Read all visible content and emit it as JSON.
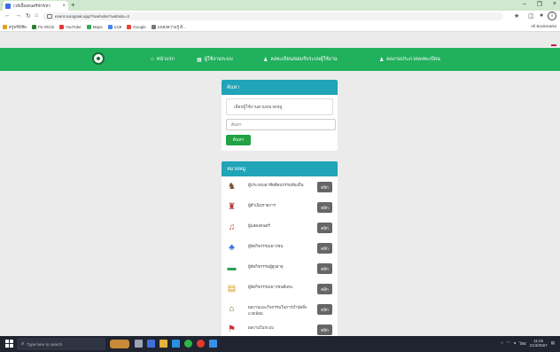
{
  "browser": {
    "tab_title": "เวลีเบื้องดนตรีจักร/หา",
    "url": "event.surognak.app/?/website/?website=3",
    "bookmarks": [
      "ครูฟรีมีชีพ",
      "Pa หน่วย",
      "YouTube",
      "Maps",
      "แปล",
      "Google",
      "แหล่งความรู้ ดิ..."
    ],
    "all_bookmarks": "All Bookmarks"
  },
  "site": {
    "nav": [
      "หน้าแรก",
      "ผู้ใช้งานระบบ",
      "ลงทะเบียน/ยอมรับระบบผู้ใช้งาน",
      "ผลงานประกวดลงทะเบียน"
    ]
  },
  "search_panel": {
    "header": "ค้นหา",
    "note": "เลือกผู้ใช้งานตามหมวดหมู่",
    "input_placeholder": "ค้นหา",
    "button": "ค้นหา"
  },
  "category_panel": {
    "header": "หมวดหมู่",
    "items": [
      {
        "label": "ผู้ประกอบอาชีพศิลปกรรมท้องถิ่น",
        "button": "คลิก",
        "icon": "dancer-icon",
        "color": "#7a4a2a"
      },
      {
        "label": "ผู้ดำเนินรายการ",
        "button": "คลิก",
        "icon": "figure-icon",
        "color": "#b03030"
      },
      {
        "label": "ผู้แสดงดนตรี",
        "button": "คลิก",
        "icon": "music-icon",
        "color": "#c83a3a"
      },
      {
        "label": "ผู้จัดกิจกรรมเยาวชน",
        "button": "คลิก",
        "icon": "tree-icon",
        "color": "#3a6ed8"
      },
      {
        "label": "ผู้จัดกิจกรรมผู้สูงอายุ",
        "button": "คลิก",
        "icon": "chair-icon",
        "color": "#2e9e57"
      },
      {
        "label": "ผู้จัดกิจกรรมเยาวชนดีเด่น",
        "button": "คลิก",
        "icon": "book-icon",
        "color": "#d8a12a"
      },
      {
        "label": "ผลงานและกิจกรรมในการบำบัดสิ่งแวดล้อม",
        "button": "คลิก",
        "icon": "house-icon",
        "color": "#5a6a2a"
      },
      {
        "label": "ผลงานในระบบ",
        "button": "คลิก",
        "icon": "flag-icon",
        "color": "#c83030"
      }
    ]
  },
  "taskbar": {
    "search_placeholder": "Type here to search",
    "time": "11:02",
    "date": "21/3/2567",
    "temp": "33°C"
  }
}
